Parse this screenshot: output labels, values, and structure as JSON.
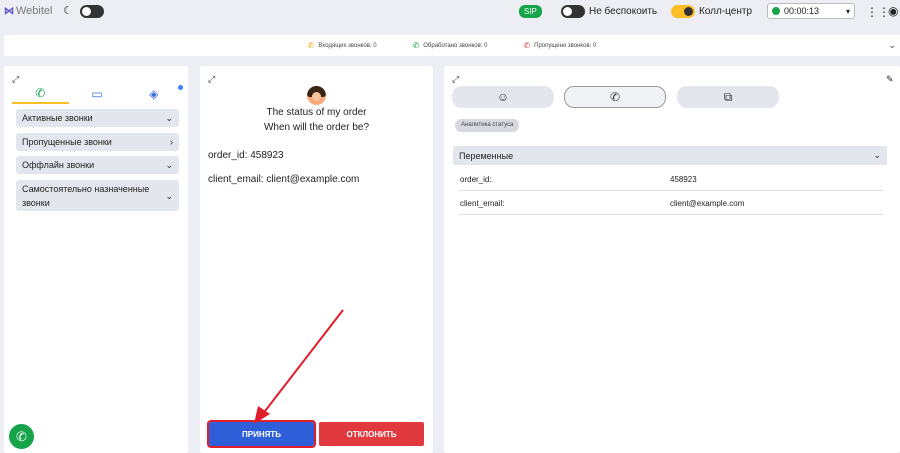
{
  "header": {
    "logo_text": "Webitel",
    "sip_label": "SIP",
    "dnd_label": "Не беспокоить",
    "callcenter_label": "Колл-центр",
    "timer": "00:00:13"
  },
  "stats": {
    "incoming": "Входящих звонков: 0",
    "handled": "Обработано звонков: 0",
    "missed": "Пропущено звонков: 0"
  },
  "left": {
    "accordions": [
      {
        "label": "Активные звонки"
      },
      {
        "label": "Пропущенные звонки"
      },
      {
        "label": "Оффлайн звонки"
      },
      {
        "label": "Самостоятельно назначенные звонки"
      }
    ]
  },
  "mid": {
    "title": "The status of my order",
    "subtitle": "When will the order be?",
    "order_id_label": "order_id:",
    "order_id_value": "458923",
    "email_label": "client_email:",
    "email_value": "client@example.com",
    "accept_label": "ПРИНЯТЬ",
    "decline_label": "ОТКЛОНИТЬ"
  },
  "right": {
    "chip": "Аналитика статуса",
    "variables_title": "Переменные",
    "rows": [
      {
        "key": "order_id:",
        "value": "458923"
      },
      {
        "key": "client_email:",
        "value": "client@example.com"
      }
    ]
  },
  "colors": {
    "accent_green": "#16a34a",
    "accept_blue": "#2f5fd8",
    "decline_red": "#e0393e",
    "highlight_red": "#e11d2a"
  }
}
